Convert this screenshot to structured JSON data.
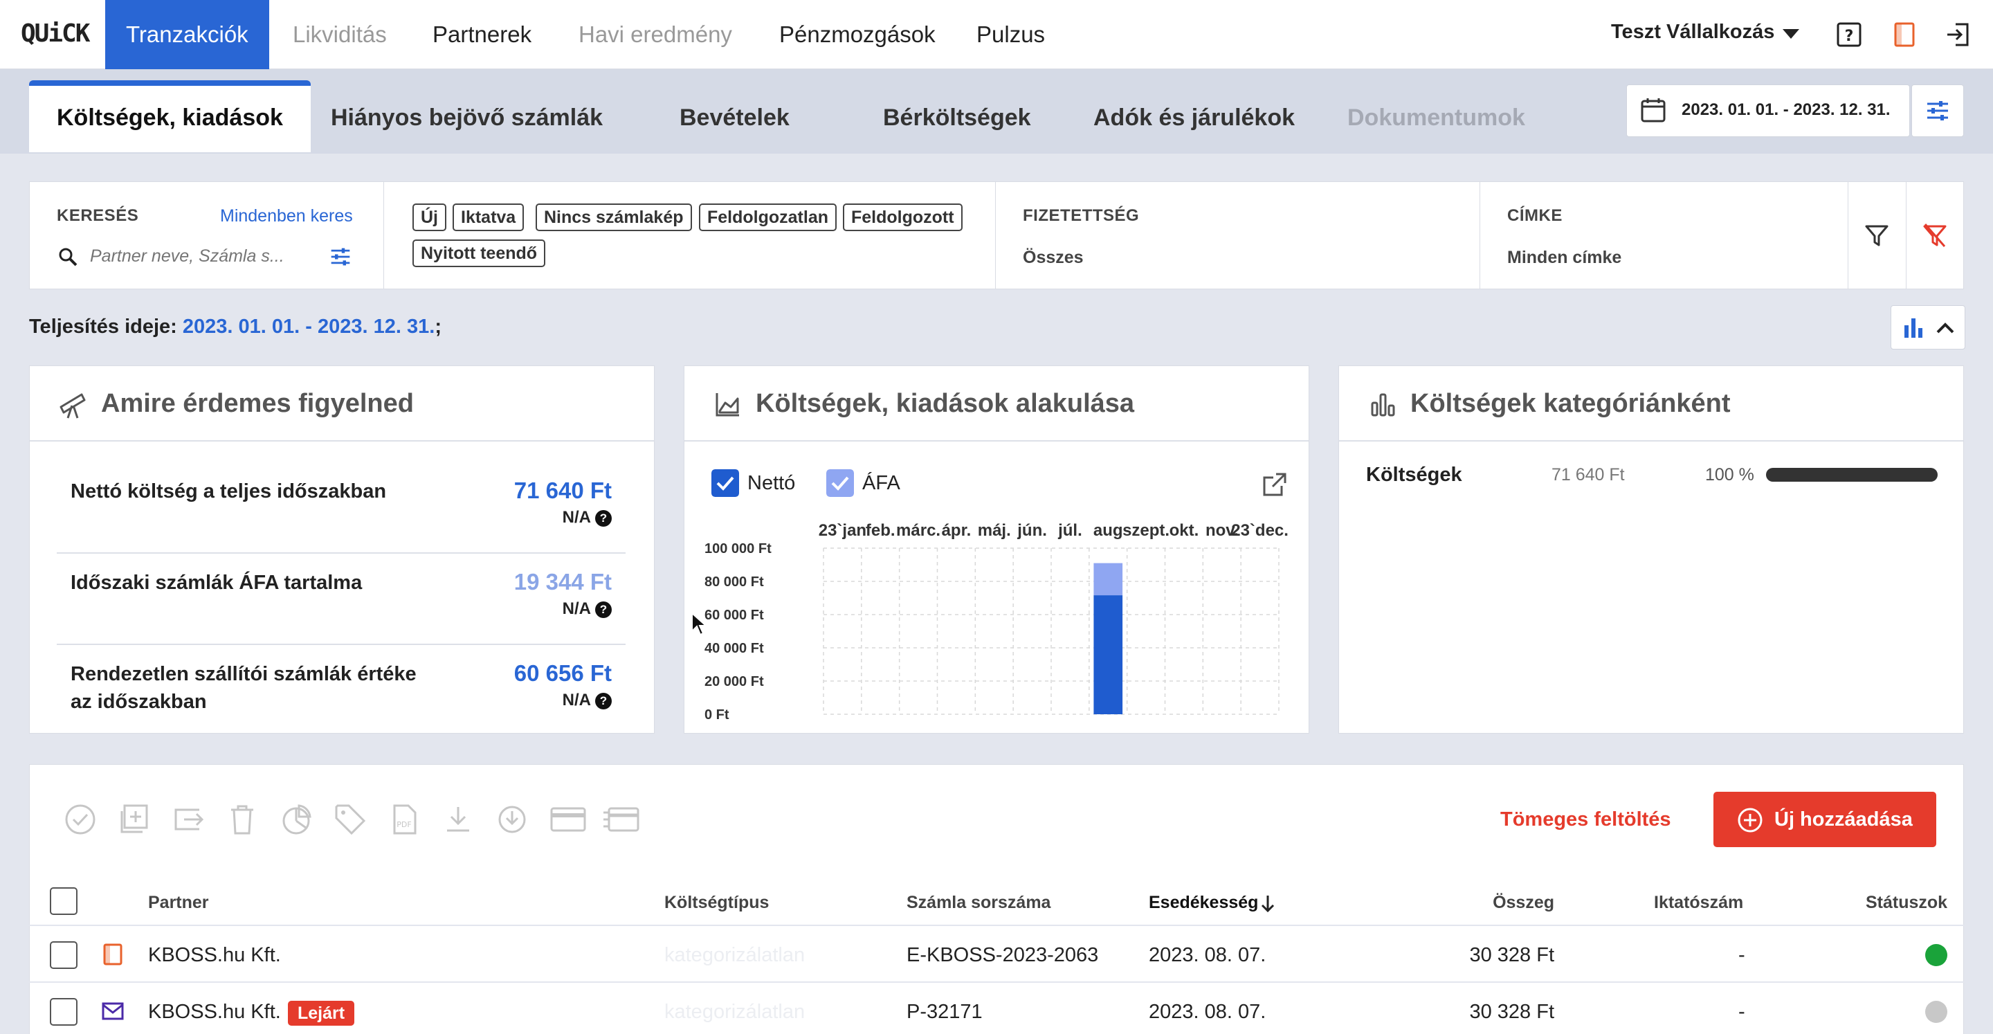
{
  "app": {
    "logo": "QUiCK"
  },
  "nav": [
    "Tranzakciók",
    "Likviditás",
    "Partnerek",
    "Havi eredmény",
    "Pénzmozgások",
    "Pulzus"
  ],
  "company": "Teszt Vállalkozás",
  "tabs": [
    "Költségek, kiadások",
    "Hiányos bejövő számlák",
    "Bevételek",
    "Bérköltségek",
    "Adók és járulékok",
    "Dokumentumok"
  ],
  "date_range": "2023. 01. 01. - 2023. 12. 31.",
  "filters": {
    "search_label": "KERESÉS",
    "search_link": "Mindenben keres",
    "search_placeholder": "Partner neve, Számla s...",
    "chips": [
      "Új",
      "Iktatva",
      "Nincs számlakép",
      "Feldolgozatlan",
      "Feldolgozott",
      "Nyitott teendő"
    ],
    "payment_label": "FIZETETTSÉG",
    "payment_value": "Összes",
    "tag_label": "CÍMKE",
    "tag_value": "Minden címke"
  },
  "period": {
    "label": "Teljesítés ideje:",
    "value": "2023. 01. 01. - 2023. 12. 31.",
    "suffix": ";"
  },
  "watch": {
    "title": "Amire érdemes figyelned",
    "items": [
      {
        "label": "Nettó költség a teljes időszakban",
        "value": "71 640 Ft",
        "note": "N/A"
      },
      {
        "label": "Időszaki számlák ÁFA tartalma",
        "value": "19 344 Ft",
        "note": "N/A"
      },
      {
        "label": "Rendezetlen szállítói számlák értéke az időszakban",
        "value": "60 656 Ft",
        "note": "N/A"
      }
    ]
  },
  "trend": {
    "title": "Költségek, kiadások alakulása",
    "legend": [
      "Nettó",
      "ÁFA"
    ]
  },
  "chart_data": {
    "type": "bar",
    "stacked": true,
    "categories": [
      "23`jan",
      "feb.",
      "márc.",
      "ápr.",
      "máj.",
      "jún.",
      "júl.",
      "aug",
      "szept.",
      "okt.",
      "nov.",
      "23`dec."
    ],
    "series": [
      {
        "name": "Nettó",
        "values": [
          0,
          0,
          0,
          0,
          0,
          0,
          0,
          71640,
          0,
          0,
          0,
          0
        ],
        "color": "#1f5ccf"
      },
      {
        "name": "ÁFA",
        "values": [
          0,
          0,
          0,
          0,
          0,
          0,
          0,
          19344,
          0,
          0,
          0,
          0
        ],
        "color": "#8fa6f2"
      }
    ],
    "yticks": [
      "100 000 Ft",
      "80 000 Ft",
      "60 000 Ft",
      "40 000 Ft",
      "20 000 Ft",
      "0 Ft"
    ],
    "ylim": [
      0,
      100000
    ],
    "grid": true
  },
  "categories_card": {
    "title": "Költségek kategóriánként",
    "rows": [
      {
        "name": "Költségek",
        "amount": "71 640 Ft",
        "percent": "100 %",
        "fraction": 1.0
      }
    ]
  },
  "actions": {
    "bulk_upload": "Tömeges feltöltés",
    "add_new": "Új hozzáadása"
  },
  "table": {
    "headers": [
      "Partner",
      "Költségtípus",
      "Számla sorszáma",
      "Esedékesség",
      "Összeg",
      "Iktatószám",
      "Státuszok"
    ],
    "rows": [
      {
        "partner": "KBOSS.hu Kft.",
        "badge": "",
        "type": "kategorizálatlan",
        "invoice": "E-KBOSS-2023-2063",
        "due": "2023. 08. 07.",
        "amount": "30 328 Ft",
        "reg": "-",
        "status_color": "#1aa33a"
      },
      {
        "partner": "KBOSS.hu Kft.",
        "badge": "Lejárt",
        "type": "kategorizálatlan",
        "invoice": "P-32171",
        "due": "2023. 08. 07.",
        "amount": "30 328 Ft",
        "reg": "-",
        "status_color": "#c8c8c8"
      }
    ]
  },
  "colors": {
    "accent": "#2966d4",
    "danger": "#e53b2c"
  },
  "icons": [
    "help-icon",
    "document-icon",
    "logout-icon",
    "calendar-icon",
    "sliders-icon",
    "search-icon",
    "filter-icon",
    "filter-clear-icon",
    "bar-chart-icon",
    "chevron-up-icon",
    "telescope-icon",
    "area-chart-icon",
    "open-external-icon",
    "check-circle-icon",
    "add-box-icon",
    "move-icon",
    "trash-icon",
    "pie-icon",
    "tag-icon",
    "pdf-icon",
    "download-icon",
    "sync-icon",
    "card-icon",
    "payment-icon",
    "arrow-down-icon",
    "plus-circle-icon",
    "invoice-icon",
    "mail-icon"
  ]
}
